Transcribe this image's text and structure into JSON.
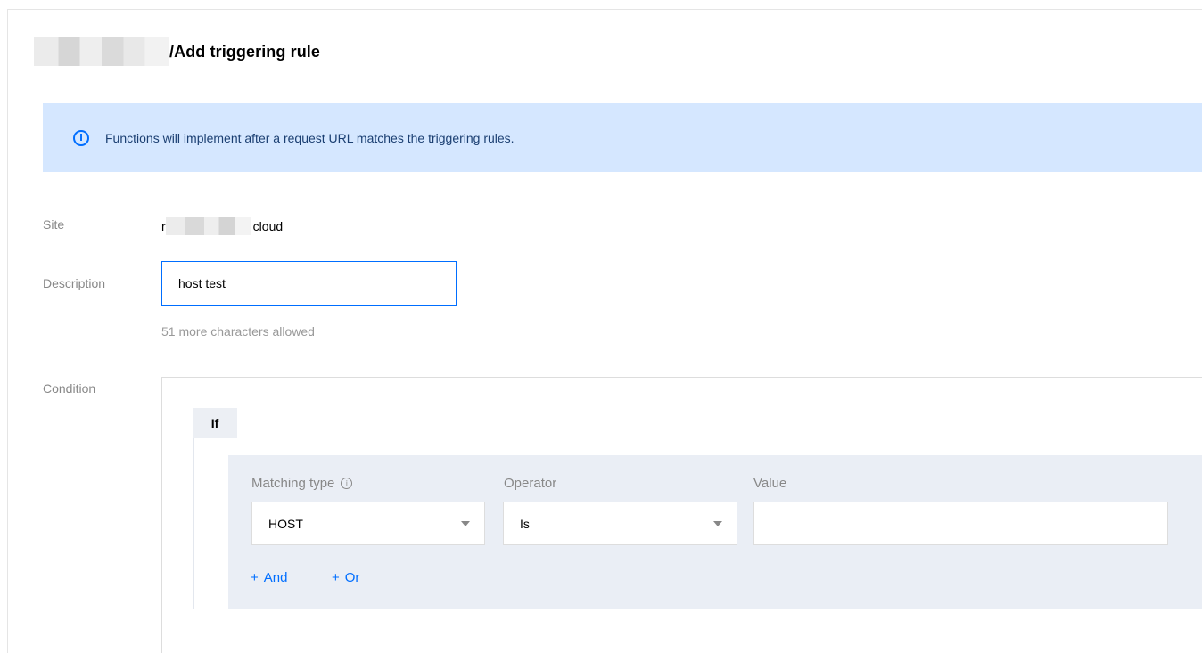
{
  "header": {
    "title": "/Add triggering rule"
  },
  "alert": {
    "text": "Functions will implement after a request URL matches the triggering rules."
  },
  "form": {
    "site_label": "Site",
    "site_prefix": "r",
    "site_suffix": "cloud",
    "description_label": "Description",
    "description_value": "host test",
    "description_hint": "51 more characters allowed",
    "condition_label": "Condition"
  },
  "condition": {
    "if_label": "If",
    "matching_type_label": "Matching type",
    "operator_label": "Operator",
    "value_label": "Value",
    "matching_type_value": "HOST",
    "operator_value": "Is",
    "value_value": "",
    "and_label": "And",
    "or_label": "Or",
    "plus_symbol": "+",
    "info_icon_glyph": "i",
    "tip_icon_glyph": "i"
  },
  "icons": {
    "alert_info": "info-circle-icon",
    "matching_type_tip": "info-circle-icon",
    "select_caret": "caret-down-icon",
    "plus": "plus-icon"
  },
  "colors": {
    "accent": "#006eff",
    "alert_bg": "#d5e7ff",
    "rule_panel_bg": "#eaeef5"
  }
}
